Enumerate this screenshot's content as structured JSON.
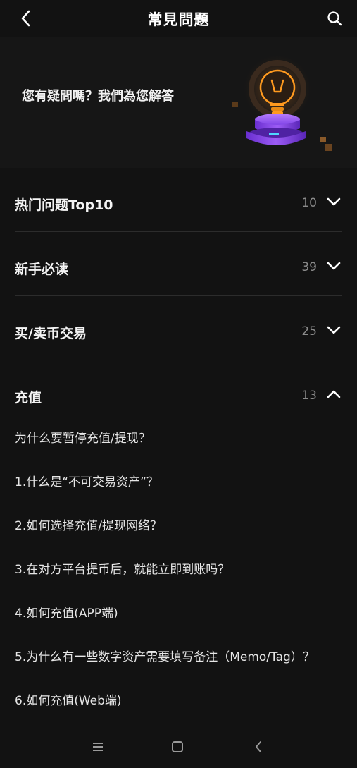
{
  "header": {
    "title": "常見問題"
  },
  "hero": {
    "text": "您有疑問嗎？我們為您解答"
  },
  "categories": [
    {
      "label": "热门问题Top10",
      "count": "10"
    },
    {
      "label": "新手必读",
      "count": "39"
    },
    {
      "label": "买/卖币交易",
      "count": "25"
    },
    {
      "label": "充值",
      "count": "13"
    }
  ],
  "questions": [
    "为什么要暂停充值/提现？",
    "1.什么是“不可交易资产”？",
    "2.如何选择充值/提现网络？",
    "3.在对方平台提币后，就能立即到账吗？",
    "4.如何充值(APP端)",
    "5.为什么有一些数字资产需要填写备注（Memo/Tag）？",
    "6.如何充值(Web端)"
  ],
  "colors": {
    "background": "#121212",
    "hero_bg": "#161616",
    "accent_purple": "#7b3fe4",
    "accent_orange": "#ff9a1f"
  }
}
